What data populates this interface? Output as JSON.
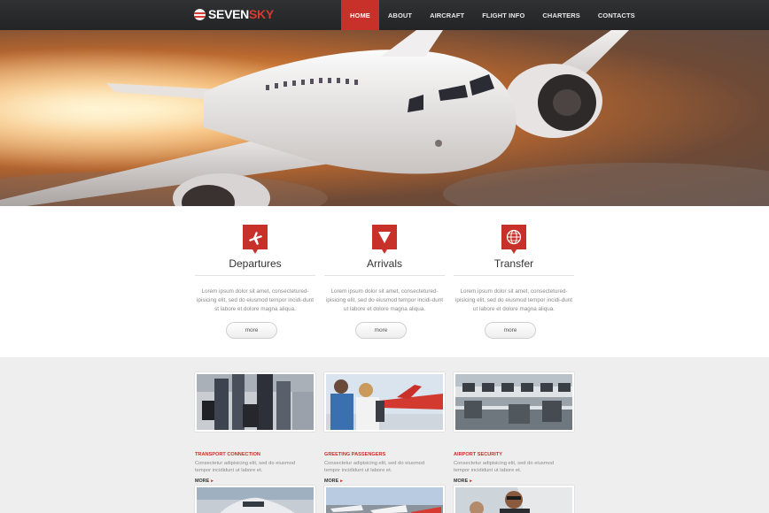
{
  "brand": {
    "name_part1": "SEVEN",
    "name_part2": "SKY",
    "accent_color": "#c8302a"
  },
  "nav": {
    "items": [
      {
        "label": "HOME",
        "active": true
      },
      {
        "label": "ABOUT",
        "active": false
      },
      {
        "label": "AIRCRAFT",
        "active": false
      },
      {
        "label": "FLIGHT INFO",
        "active": false
      },
      {
        "label": "CHARTERS",
        "active": false
      },
      {
        "label": "CONTACTS",
        "active": false
      }
    ]
  },
  "hero": {
    "slides": 3,
    "active_slide": 2
  },
  "services": [
    {
      "title": "Departures",
      "icon": "airplane-icon",
      "text": "Lorem ipsum dolor sit amet, consectetured-ipisicing elit, sed do eiusmod tempor incidi-dunt st labore et dolore magna aliqua.",
      "more": "more"
    },
    {
      "title": "Arrivals",
      "icon": "down-arrow-icon",
      "text": "Lorem ipsum dolor sit amet, consectetured-ipisicing elit, sed do eiusmod tempor incidi-dunt ut labore et dolore magna aliqua.",
      "more": "more"
    },
    {
      "title": "Transfer",
      "icon": "globe-icon",
      "text": "Lorem ipsum dolor sit amet, consectetured-ipisicing elit, sed do eiusmod tempor incidi-dunt ut labore et dolore magna aliqua.",
      "more": "more"
    }
  ],
  "gallery": [
    {
      "title": "TRANSPORT CONNECTION",
      "text": "Consectetur adipisicing elit, sed do eiusmod tempor incididunt ut labore et.",
      "more": "MORE"
    },
    {
      "title": "GREETING PASSENGERS",
      "text": "Consectetur adipisicing elit, sed do eiusmod tempor incididunt ut labore et.",
      "more": "MORE"
    },
    {
      "title": "AIRPORT SECURITY",
      "text": "Consectetur adipisicing elit, sed do eiusmod tempor incididunt ut labore et.",
      "more": "MORE"
    }
  ]
}
